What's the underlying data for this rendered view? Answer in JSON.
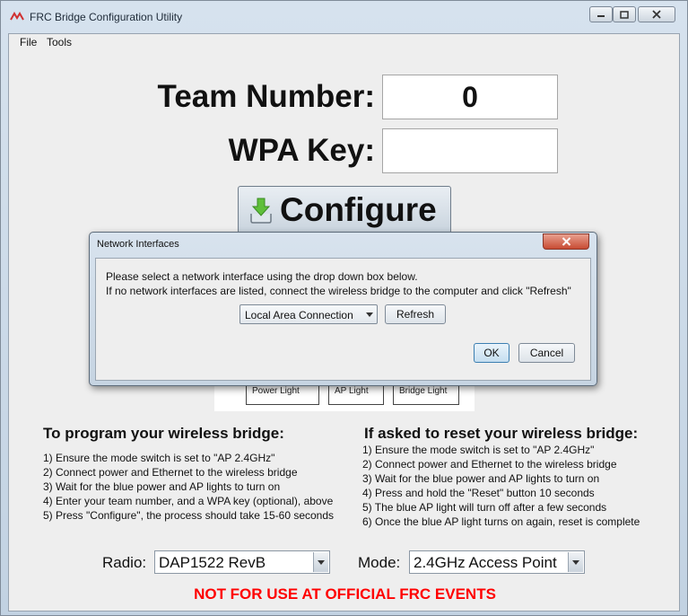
{
  "window": {
    "title": "FRC Bridge Configuration Utility"
  },
  "menu": [
    "File",
    "Tools"
  ],
  "team": {
    "label": "Team Number:",
    "value": "0"
  },
  "wpa": {
    "label": "WPA Key:",
    "value": ""
  },
  "configure_button": "Configure",
  "lights": [
    "Power Light",
    "AP Light",
    "Bridge Light"
  ],
  "program": {
    "title": "To program your wireless bridge:",
    "steps": [
      "1) Ensure the mode switch is set to \"AP 2.4GHz\"",
      "2) Connect power and Ethernet to the wireless bridge",
      "3) Wait for the blue power and AP lights to turn on",
      "4) Enter your team number, and a WPA key (optional), above",
      "5) Press \"Configure\", the process should take 15-60 seconds"
    ]
  },
  "reset": {
    "title": "If asked to reset your wireless bridge:",
    "steps": [
      "1) Ensure the mode switch is set to \"AP 2.4GHz\"",
      "2) Connect power and Ethernet to the wireless bridge",
      "3) Wait for the blue power and AP lights to turn on",
      "4) Press and hold the \"Reset\" button 10 seconds",
      "5) The blue AP light will turn off after a few seconds",
      "6) Once the blue AP light turns on again, reset is complete"
    ]
  },
  "radio": {
    "label": "Radio:",
    "value": "DAP1522 RevB"
  },
  "mode": {
    "label": "Mode:",
    "value": "2.4GHz Access Point"
  },
  "warning": "NOT FOR USE AT OFFICIAL FRC EVENTS",
  "dialog": {
    "title": "Network Interfaces",
    "message_line1": "Please select a network interface using the drop down box below.",
    "message_line2": "If no network interfaces are listed, connect the wireless bridge to the computer and click \"Refresh\"",
    "interface": "Local Area Connection",
    "refresh": "Refresh",
    "ok": "OK",
    "cancel": "Cancel"
  },
  "colors": {
    "warning": "#ff0000",
    "close_button": "#c84b33"
  },
  "icons": [
    "app-logo-icon",
    "minimize-icon",
    "maximize-icon",
    "close-icon",
    "download-icon",
    "dropdown-arrow-icon"
  ]
}
